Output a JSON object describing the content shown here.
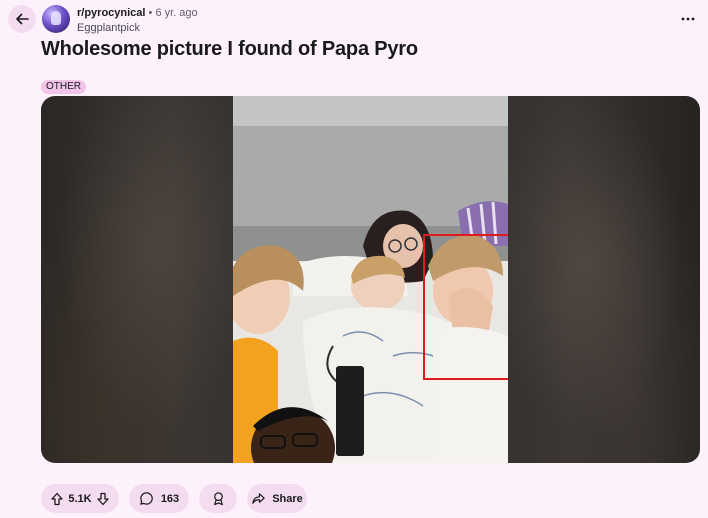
{
  "header": {
    "subreddit": "r/pyrocynical",
    "separator": "•",
    "time_ago": "6 yr. ago",
    "author": "Eggplantpick"
  },
  "post": {
    "title": "Wholesome picture I found of Papa Pyro",
    "flair": "OTHER"
  },
  "actions": {
    "score": "5.1K",
    "comments": "163",
    "share_label": "Share"
  },
  "icons": {
    "back": "arrow-left-icon",
    "more": "ellipsis-icon",
    "upvote": "arrow-up-icon",
    "downvote": "arrow-down-icon",
    "comments": "speech-bubble-icon",
    "award": "award-icon",
    "share": "share-arrow-icon"
  },
  "colors": {
    "page_bg": "#fdf2fb",
    "pill_bg": "#f4dcf0",
    "flair_bg": "#f2c4e8",
    "highlight_box": "#e01b1b"
  }
}
